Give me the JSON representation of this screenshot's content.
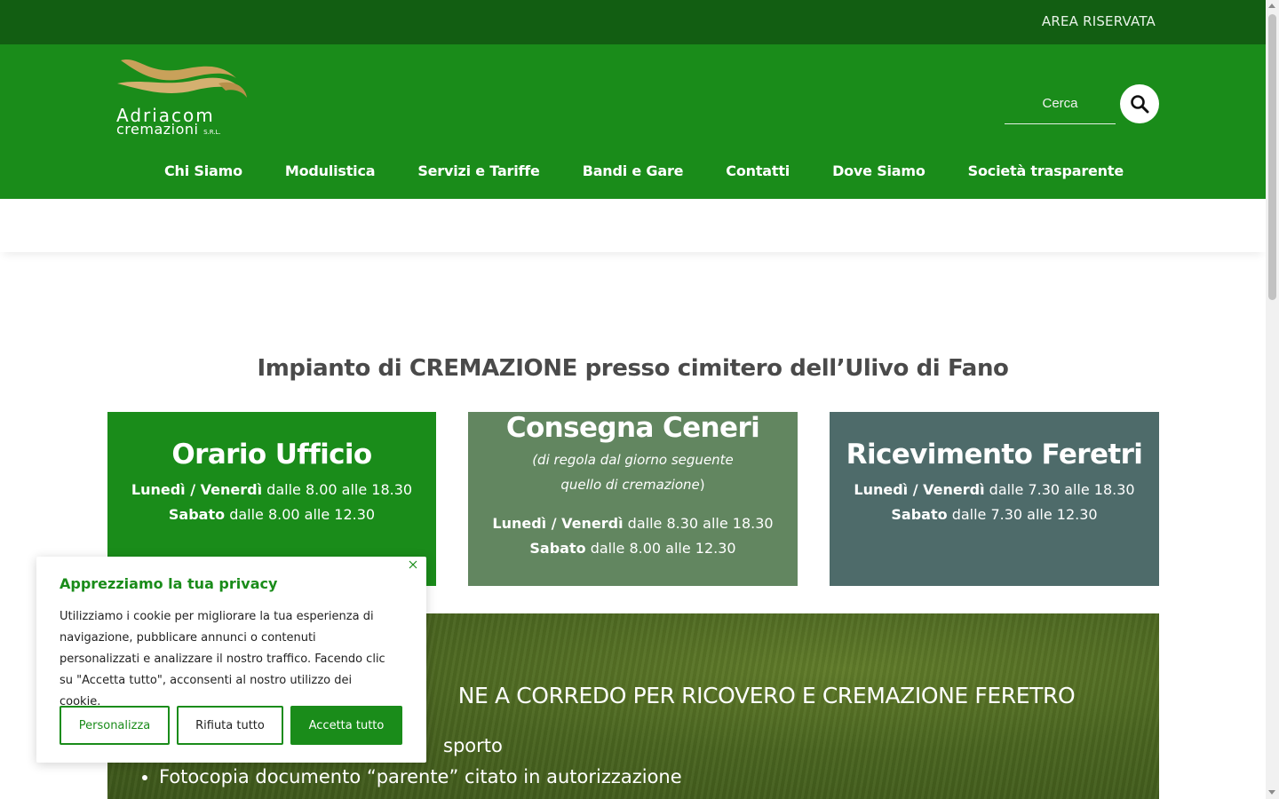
{
  "topbar": {
    "area_label": "AREA RISERVATA"
  },
  "logo": {
    "brand": "Adriacom",
    "sub": "cremazioni",
    "suffix": "S.R.L."
  },
  "search": {
    "placeholder": "Cerca",
    "icon": "search-icon"
  },
  "nav": {
    "items": [
      "Chi Siamo",
      "Modulistica",
      "Servizi e Tariffe",
      "Bandi e Gare",
      "Contatti",
      "Dove Siamo",
      "Società trasparente"
    ]
  },
  "headline": "Impianto di CREMAZIONE presso cimitero dell’Ulivo di Fano",
  "boxes": {
    "office": {
      "title": "Orario Ufficio",
      "weekdays_label": "Lunedì / Venerdì",
      "weekdays_hours": "dalle 8.00 alle 18.30",
      "saturday_label": "Sabato",
      "saturday_hours": "dalle 8.00 alle 12.30"
    },
    "ashes": {
      "title": "Consegna Ceneri",
      "note_line1": "(di regola dal giorno seguente",
      "note_line2": "quello di cremazione",
      "note_close": ")",
      "weekdays_label": "Lunedì / Venerdì",
      "weekdays_hours": "dalle 8.30 alle 18.30",
      "saturday_label": "Sabato",
      "saturday_hours": "dalle 8.00 alle 12.30"
    },
    "coffins": {
      "title": "Ricevimento Feretri",
      "weekdays_label": "Lunedì / Venerdì",
      "weekdays_hours": "dalle 7.30 alle 18.30",
      "saturday_label": "Sabato",
      "saturday_hours": "dalle 7.30 alle 12.30"
    }
  },
  "documents": {
    "heading_visible": "NE A CORREDO PER RICOVERO E CREMAZIONE FERETRO",
    "items": [
      "sporto",
      "Fotocopia documento “parente” citato in autorizzazione"
    ]
  },
  "cookie": {
    "title": "Apprezziamo la tua privacy",
    "text": "Utilizziamo i cookie per migliorare la tua esperienza di navigazione, pubblicare annunci o contenuti personalizzati e analizzare il nostro traffico. Facendo clic su \"Accetta tutto\", acconsenti al nostro utilizzo dei cookie.",
    "customize": "Personalizza",
    "reject": "Rifiuta tutto",
    "accept": "Accetta tutto"
  },
  "colors": {
    "topbar": "#125e12",
    "header": "#1a8c1a",
    "box_office": "#1a8c1a",
    "box_ashes": "#628660",
    "box_coffins": "#4e6b6a",
    "logo_gold": "#c9a15a"
  }
}
